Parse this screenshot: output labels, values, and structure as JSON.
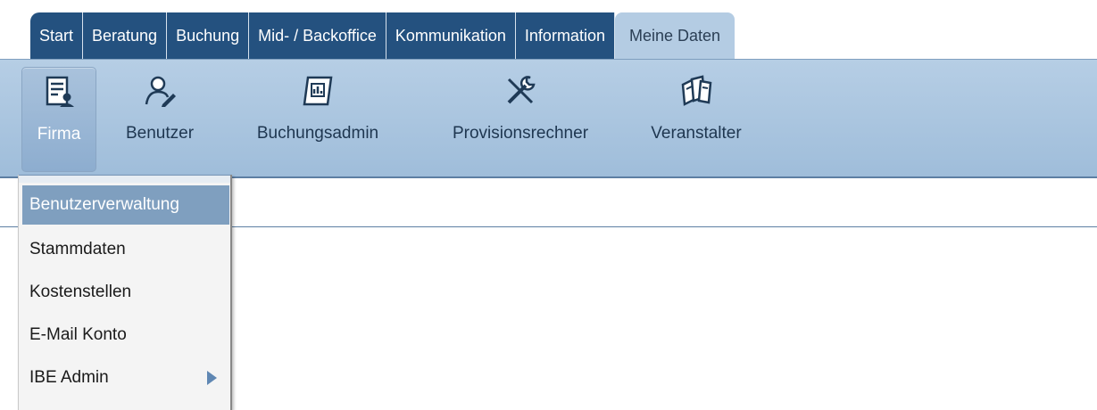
{
  "tabs": [
    {
      "label": "Start"
    },
    {
      "label": "Beratung"
    },
    {
      "label": "Buchung"
    },
    {
      "label": "Mid- / Backoffice"
    },
    {
      "label": "Kommunikation"
    },
    {
      "label": "Information"
    },
    {
      "label": "Meine Daten",
      "active": true
    }
  ],
  "ribbon": {
    "buttons": [
      {
        "label": "Firma",
        "icon": "company-document-icon",
        "selected": true
      },
      {
        "label": "Benutzer",
        "icon": "user-edit-icon"
      },
      {
        "label": "Buchungsadmin",
        "icon": "booking-admin-icon"
      },
      {
        "label": "Provisionsrechner",
        "icon": "tools-icon"
      },
      {
        "label": "Veranstalter",
        "icon": "brochures-icon"
      }
    ]
  },
  "dropdown": {
    "items": [
      {
        "label": "Benutzerverwaltung",
        "highlighted": true
      },
      {
        "label": "Stammdaten"
      },
      {
        "label": "Kostenstellen"
      },
      {
        "label": "E-Mail Konto"
      },
      {
        "label": "IBE Admin",
        "submenu": true
      }
    ]
  },
  "colors": {
    "tab_bg": "#24517f",
    "tab_active_bg": "#b4cce3",
    "ribbon_bg": "#b6cee5",
    "menu_highlight": "#7f9fbf"
  }
}
